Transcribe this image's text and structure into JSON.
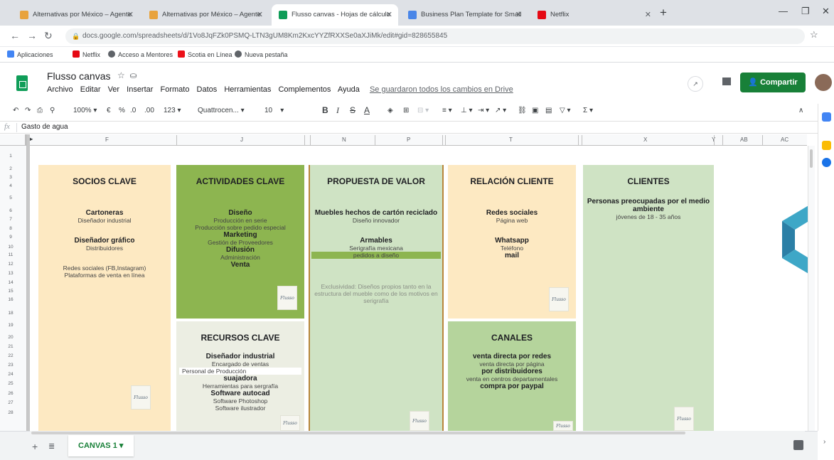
{
  "browser": {
    "tabs": [
      {
        "title": "Alternativas por México – Agente",
        "icon_color": "#e8a33d"
      },
      {
        "title": "Alternativas por México – Agente",
        "icon_color": "#e8a33d"
      },
      {
        "title": "Flusso canvas - Hojas de cálculo",
        "icon_color": "#0f9d58"
      },
      {
        "title": "Business Plan Template for Small",
        "icon_color": "#4a86e8"
      },
      {
        "title": "Netflix",
        "icon_color": "#e50914"
      }
    ],
    "url": "docs.google.com/spreadsheets/d/1Vo8JqFZk0PSMQ-LTN3gUM8Km2KxcYYZfRXXSe0aXJiMk/edit#gid=828655845",
    "bookmarks": [
      "Aplicaciones",
      "Netflix",
      "Acceso a Mentores",
      "Scotia en Línea",
      "Nueva pestaña"
    ]
  },
  "doc": {
    "title": "Flusso canvas",
    "menus": [
      "Archivo",
      "Editar",
      "Ver",
      "Insertar",
      "Formato",
      "Datos",
      "Herramientas",
      "Complementos",
      "Ayuda"
    ],
    "saved_status": "Se guardaron todos los cambios en Drive",
    "share_label": "Compartir"
  },
  "toolbar": {
    "zoom": "100%",
    "currency": "€",
    "percent": "%",
    "dec_less": ".0",
    "dec_more": ".00",
    "format_num": "123",
    "font": "Quattrocen...",
    "font_size": "10",
    "bold": "B",
    "italic": "I",
    "strike": "S",
    "text_color": "A",
    "functions": "Σ"
  },
  "formula": {
    "value": "Gasto de agua"
  },
  "grid": {
    "columns": [
      "F",
      "J",
      "N",
      "P",
      "T",
      "X",
      "Y",
      "AB",
      "AC"
    ],
    "rows": [
      "1",
      "2",
      "3",
      "4",
      "5",
      "6",
      "7",
      "8",
      "9",
      "10",
      "11",
      "12",
      "13",
      "14",
      "15",
      "16",
      "18",
      "19",
      "20",
      "21",
      "22",
      "23",
      "24",
      "25",
      "26",
      "27",
      "28"
    ]
  },
  "canvas": {
    "socios": {
      "title": "SOCIOS CLAVE",
      "l1": "Cartoneras",
      "l2": "Diseñador industrial",
      "l3": "Diseñador gráfico",
      "l4": "Distribuidores",
      "l5": "Redes sociales (FB,Instagram)",
      "l6": "Plataformas de venta en línea"
    },
    "actividades": {
      "title": "ACTIVIDADES CLAVE",
      "l1": "Diseño",
      "l2": "Producción en serie",
      "l3": "Producción sobre pedido especial",
      "l4": "Marketing",
      "l5": "Gestión de Proveedores",
      "l6": "Difusión",
      "l7": "Administración",
      "l8": "Venta"
    },
    "propuesta": {
      "title": "PROPUESTA DE VALOR",
      "l1": "Muebles hechos de cartón reciclado",
      "l2": "Diseño innovador",
      "l3": "Armables",
      "l4": "Serigrafía mexicana",
      "l5": "pedidos a diseño",
      "l6": "Exclusividad: Diseños propios tanto en la estructura del mueble como de los motivos en serigrafía"
    },
    "relacion": {
      "title": "RELACIÓN CLIENTE",
      "l1": "Redes sociales",
      "l2": "Página web",
      "l3": "Whatsapp",
      "l4": "Teléfono",
      "l5": "mail"
    },
    "clientes": {
      "title": "CLIENTES",
      "l1": "Personas preocupadas por el medio ambiente",
      "l2": "jóvenes de 18 - 35 años"
    },
    "recursos": {
      "title": "RECURSOS CLAVE",
      "l1": "Diseñador industrial",
      "l2": "Encargado de ventas",
      "l3": "Personal de Producción",
      "l4": "suajadora",
      "l5": "Herramientas para sergrafía",
      "l6": "Software autocad",
      "l7": "Software Photoshop",
      "l8": "Software ilustrador"
    },
    "canales": {
      "title": "CANALES",
      "l1": "venta directa por redes",
      "l2": "venta directa por página",
      "l3": "por distribuidores",
      "l4": "venta en centros departamentales",
      "l5": "compra por paypal"
    },
    "stamp_text": "Flusso"
  },
  "sheet": {
    "tab_label": "CANVAS 1 ▾"
  },
  "colors": {
    "green": "#8db550",
    "cream": "#fde9c2",
    "light_green": "#cfe3c4",
    "share": "#188038"
  }
}
